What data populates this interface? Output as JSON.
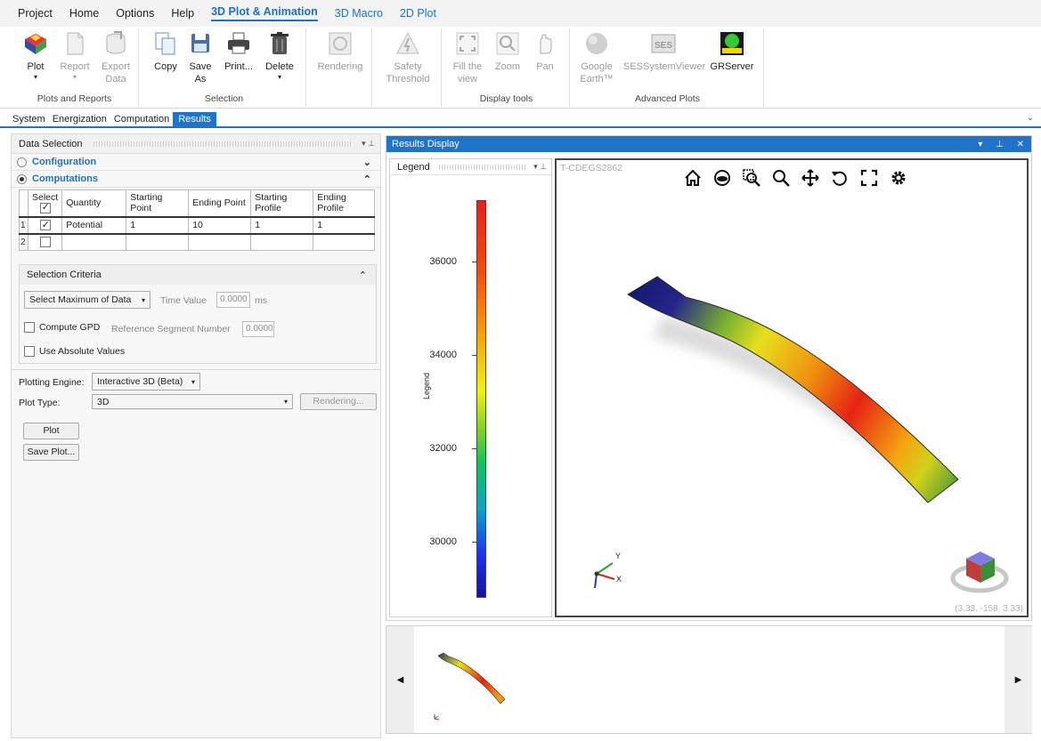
{
  "menu": {
    "items": [
      "Project",
      "Home",
      "Options",
      "Help",
      "3D Plot & Animation",
      "3D Macro",
      "2D Plot"
    ],
    "active_index": 4
  },
  "ribbon": {
    "groups": {
      "plots": {
        "label": "Plots and Reports",
        "buttons": [
          {
            "line1": "Plot",
            "line2": "",
            "caret": "▾",
            "icon": "plot-icon"
          },
          {
            "line1": "Report",
            "line2": "",
            "caret": "▾",
            "icon": "report-icon"
          },
          {
            "line1": "Export",
            "line2": "Data",
            "caret": "",
            "icon": "export-icon"
          }
        ]
      },
      "selection": {
        "label": "Selection",
        "buttons": [
          {
            "line1": "Copy",
            "line2": "",
            "caret": "",
            "icon": "copy-icon"
          },
          {
            "line1": "Save",
            "line2": "As",
            "caret": "",
            "icon": "save-as-icon"
          },
          {
            "line1": "Print...",
            "line2": "",
            "caret": "",
            "icon": "printer-icon"
          },
          {
            "line1": "Delete",
            "line2": "",
            "caret": "▾",
            "icon": "trash-icon"
          }
        ]
      },
      "rendering": {
        "line1": "Rendering",
        "icon": "rendering-icon"
      },
      "safety": {
        "line1": "Safety",
        "line2": "Threshold",
        "icon": "safety-threshold-icon"
      },
      "display": {
        "label": "Display tools",
        "buttons": [
          {
            "line1": "Fill the",
            "line2": "view",
            "icon": "fill-view-icon"
          },
          {
            "line1": "Zoom",
            "line2": "",
            "icon": "zoom-icon"
          },
          {
            "line1": "Pan",
            "line2": "",
            "icon": "pan-icon"
          }
        ]
      },
      "advanced": {
        "label": "Advanced Plots",
        "buttons": [
          {
            "line1": "Google",
            "line2": "Earth™",
            "icon": "globe-icon"
          },
          {
            "line1": "SESSystemViewer",
            "line2": "",
            "icon": "ses-viewer-icon"
          },
          {
            "line1": "GRServer",
            "line2": "",
            "icon": "grserver-icon"
          }
        ]
      }
    }
  },
  "tabs": {
    "items": [
      "System",
      "Energization",
      "Computation",
      "Results"
    ],
    "active_index": 3
  },
  "data_selection": {
    "title": "Data Selection",
    "configuration_label": "Configuration",
    "computations_label": "Computations",
    "table": {
      "headers": [
        "Select",
        "Quantity",
        "Starting Point",
        "Ending Point",
        "Starting Profile",
        "Ending Profile"
      ],
      "rows": [
        {
          "num": "1",
          "checked": true,
          "quantity": "Potential",
          "start_point": "1",
          "end_point": "10",
          "start_profile": "1",
          "end_profile": "1"
        },
        {
          "num": "2",
          "checked": false,
          "quantity": "",
          "start_point": "",
          "end_point": "",
          "start_profile": "",
          "end_profile": ""
        }
      ]
    }
  },
  "selection_criteria": {
    "title": "Selection Criteria",
    "mode": "Select Maximum of Data",
    "time_value_label": "Time Value",
    "time_value": "0.0000",
    "time_unit": "ms",
    "compute_gpd_label": "Compute GPD",
    "ref_segment_label": "Reference Segment Number",
    "ref_segment_value": "0.0000",
    "abs_values_label": "Use Absolute Values"
  },
  "plotting": {
    "engine_label": "Plotting Engine:",
    "engine_value": "Interactive 3D (Beta)",
    "type_label": "Plot Type:",
    "type_value": "3D",
    "rendering_button": "Rendering...",
    "plot_button": "Plot",
    "save_plot_button": "Save Plot..."
  },
  "results_display": {
    "title": "Results Display",
    "legend_title": "Legend",
    "legend_axis_label": "Legend",
    "legend_ticks": [
      "36000",
      "34000",
      "32000",
      "30000"
    ],
    "viewport_label": "T-CDEGS2862",
    "axis_y": "Y",
    "axis_x": "X",
    "coords": "(3.33, -158, 3.33)",
    "colors": {
      "low": "#141496",
      "mid": "#f0f014",
      "high": "#e8201a",
      "accent": "#1f73c8"
    }
  }
}
